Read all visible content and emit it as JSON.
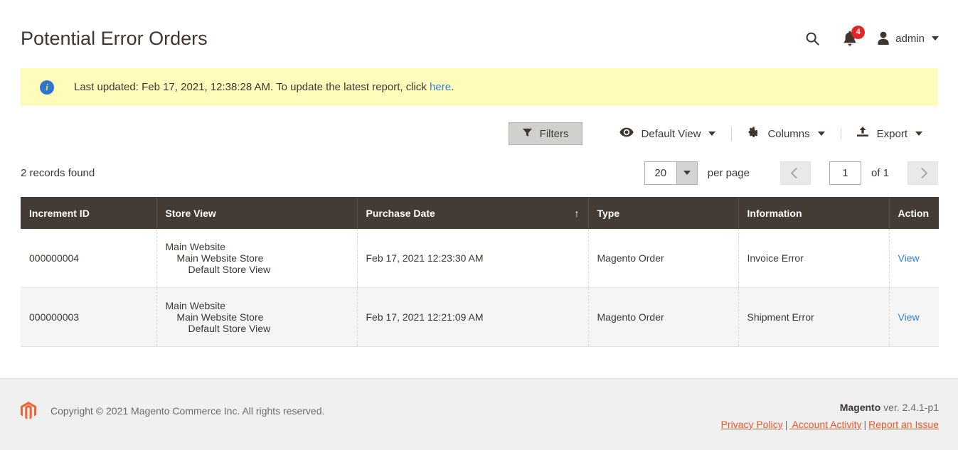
{
  "header": {
    "title": "Potential Error Orders",
    "search_icon": "search-icon",
    "notifications": {
      "icon": "bell-icon",
      "count": "4"
    },
    "account": {
      "icon": "user-icon",
      "name": "admin",
      "caret": "chevron-down-icon"
    }
  },
  "notice": {
    "icon": "info-icon",
    "text_before": "Last updated: Feb 17, 2021, 12:38:28 AM. To update the latest report, click ",
    "link": "here",
    "text_after": "."
  },
  "toolbar": {
    "filters_label": "Filters",
    "filters_icon": "funnel-icon",
    "view_label": "Default View",
    "view_icon": "eye-icon",
    "columns_label": "Columns",
    "columns_icon": "gear-icon",
    "export_label": "Export",
    "export_icon": "upload-icon"
  },
  "grid_controls": {
    "records_found": "2 records found",
    "per_page_value": "20",
    "per_page_label": "per page",
    "page_value": "1",
    "of_label": "of 1",
    "prev_icon": "chevron-left-icon",
    "next_icon": "chevron-right-icon"
  },
  "table": {
    "columns": [
      {
        "label": "Increment ID",
        "sorted": false
      },
      {
        "label": "Store View",
        "sorted": false
      },
      {
        "label": "Purchase Date",
        "sorted": true,
        "sort_arrow": "↑"
      },
      {
        "label": "Type",
        "sorted": false
      },
      {
        "label": "Information",
        "sorted": false
      },
      {
        "label": "Action",
        "sorted": false
      }
    ],
    "rows": [
      {
        "increment_id": "000000004",
        "store_view": {
          "website": "Main Website",
          "store": "Main Website Store",
          "view": "Default Store View"
        },
        "purchase_date": "Feb 17, 2021 12:23:30 AM",
        "type": "Magento Order",
        "information": "Invoice Error",
        "action": "View"
      },
      {
        "increment_id": "000000003",
        "store_view": {
          "website": "Main Website",
          "store": "Main Website Store",
          "view": "Default Store View"
        },
        "purchase_date": "Feb 17, 2021 12:21:09 AM",
        "type": "Magento Order",
        "information": "Shipment Error",
        "action": "View"
      }
    ]
  },
  "footer": {
    "logo_icon": "magento-logo-icon",
    "copyright": "Copyright © 2021 Magento Commerce Inc. All rights reserved.",
    "brand": "Magento",
    "version": " ver. 2.4.1-p1",
    "links": [
      {
        "label": "Privacy Policy"
      },
      {
        "label": " Account Activity"
      },
      {
        "label": "Report an Issue"
      }
    ],
    "separator": "|"
  },
  "colors": {
    "accent_blue": "#2f7fd8",
    "header_dark": "#433b34",
    "notice_yellow": "#fffbbb",
    "badge_red": "#e22626",
    "link_orange": "#e9562a"
  }
}
